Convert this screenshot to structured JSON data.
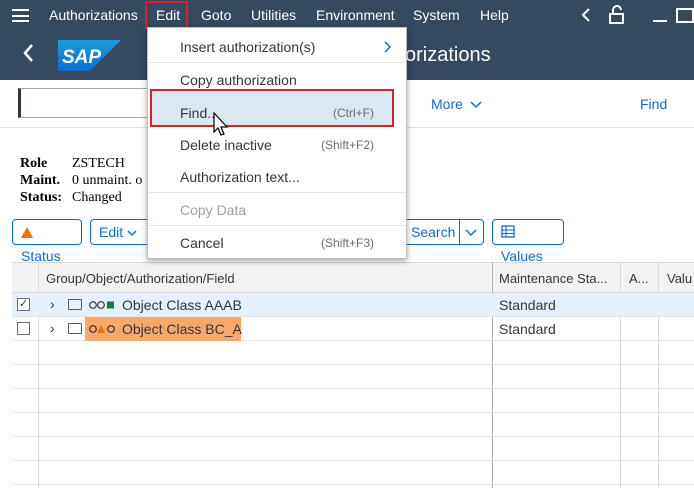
{
  "menubar": {
    "items": [
      "Authorizations",
      "Edit",
      "Goto",
      "Utilities",
      "Environment",
      "System",
      "Help"
    ],
    "mnemonics": [
      "A",
      "E",
      "G",
      "U",
      "v",
      "S",
      "H"
    ]
  },
  "titlebar": {
    "title": "orizations",
    "logo": "SAP"
  },
  "toolbar": {
    "command_value": "",
    "more_label": "More",
    "find_label": "Find"
  },
  "header": {
    "role_label": "Role",
    "role_value": "ZSTECH",
    "maint_label": "Maint.",
    "maint_value": "0 unmaint. o",
    "status_label": "Status:",
    "status_value": "Changed"
  },
  "buttons": {
    "status": "Status",
    "edit": "Edit",
    "search": "Search",
    "values": "Values"
  },
  "table": {
    "columns": [
      "Group/Object/Authorization/Field",
      "Maintenance Sta...",
      "A...",
      "Valu"
    ],
    "rows": [
      {
        "checked": true,
        "name": "Object Class AAAB",
        "maintenance": "Standard"
      },
      {
        "checked": false,
        "name": "Object Class BC_A",
        "maintenance": "Standard"
      }
    ]
  },
  "dropdown": {
    "items": [
      {
        "label": "Insert authorization(s)",
        "shortcut": "",
        "disabled": false
      },
      {
        "label": "Copy authorization",
        "shortcut": "",
        "disabled": false
      },
      {
        "label": "Find...",
        "shortcut": "(Ctrl+F)",
        "disabled": false
      },
      {
        "label": "Delete inactive",
        "shortcut": "(Shift+F2)",
        "disabled": false
      },
      {
        "label": "Authorization text...",
        "shortcut": "",
        "disabled": false
      },
      {
        "label": "Copy Data",
        "shortcut": "",
        "disabled": true
      },
      {
        "label": "Cancel",
        "shortcut": "(Shift+F3)",
        "disabled": false
      }
    ]
  },
  "colors": {
    "shell": "#354a5f",
    "accent": "#0a6ed1",
    "highlight": "#f9a86a",
    "focus_border": "#d8222a"
  }
}
